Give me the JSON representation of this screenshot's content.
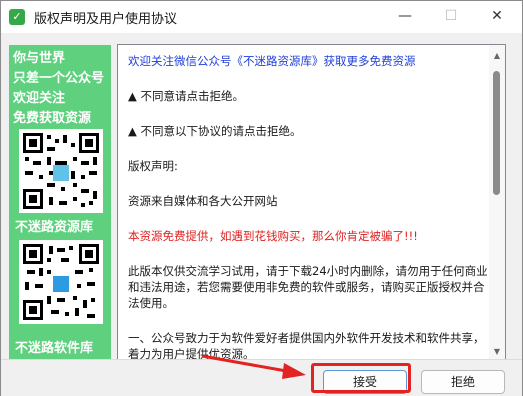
{
  "window": {
    "title": "版权声明及用户使用协议",
    "icon": "app-shield-icon",
    "controls": {
      "minimize": "—",
      "maximize": "☐",
      "close": "✕"
    }
  },
  "promo": {
    "lines": [
      "你与世界",
      "只差一个公众号",
      "欢迎关注",
      "免费获取资源"
    ],
    "qr1_label": "不迷路资源库",
    "qr2_label": "不迷路软件库",
    "background": "#5fd17e"
  },
  "agreement": {
    "paragraphs": [
      {
        "text": "欢迎关注微信公众号《不迷路资源库》获取更多免费资源",
        "style": "blue"
      },
      {
        "text": "▲ 不同意请点击拒绝。",
        "style": "normal"
      },
      {
        "text": "▲ 不同意以下协议的请点击拒绝。",
        "style": "normal"
      },
      {
        "text": "版权声明:",
        "style": "normal"
      },
      {
        "text": "资源来自媒体和各大公开网站",
        "style": "normal"
      },
      {
        "text": "本资源免费提供，如遇到花钱购买，那么你肯定被骗了!!!",
        "style": "red"
      },
      {
        "text": "此版本仅供交流学习试用，请于下载24小时内删除，请勿用于任何商业和违法用途，若您需要使用非免费的软件或服务，请购买正版授权并合法使用。",
        "style": "normal"
      },
      {
        "text": "一、公众号致力于为软件爱好者提供国内外软件开发技术和软件共享，着力为用户提供优资源。",
        "style": "normal"
      }
    ]
  },
  "buttons": {
    "accept": "接受",
    "reject": "拒绝"
  },
  "colors": {
    "highlight": "#e32222",
    "link_blue": "#1f3fd9",
    "warning_red": "#e02020"
  }
}
